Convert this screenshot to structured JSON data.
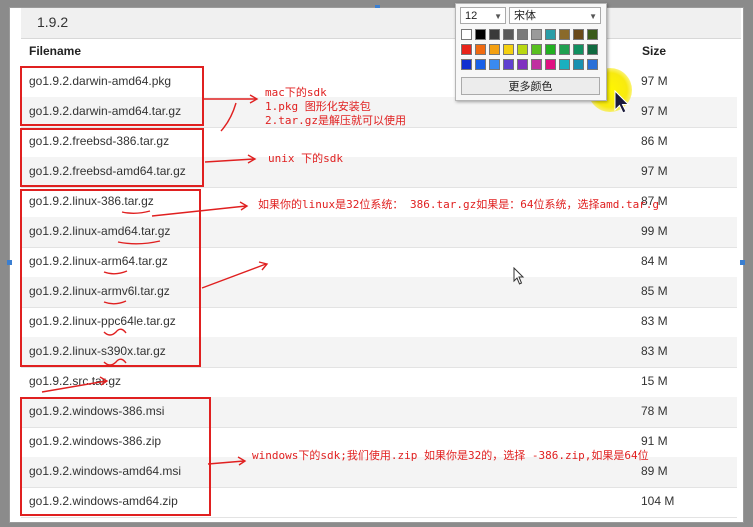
{
  "version": "1.9.2",
  "columns": {
    "filename": "Filename",
    "size": "Size"
  },
  "files": [
    {
      "name": "go1.9.2.darwin-amd64.pkg",
      "size": "97 M"
    },
    {
      "name": "go1.9.2.darwin-amd64.tar.gz",
      "size": "97 M"
    },
    {
      "name": "go1.9.2.freebsd-386.tar.gz",
      "size": "86 M"
    },
    {
      "name": "go1.9.2.freebsd-amd64.tar.gz",
      "size": "97 M"
    },
    {
      "name": "go1.9.2.linux-386.tar.gz",
      "size": "87 M"
    },
    {
      "name": "go1.9.2.linux-amd64.tar.gz",
      "size": "99 M"
    },
    {
      "name": "go1.9.2.linux-arm64.tar.gz",
      "size": "84 M"
    },
    {
      "name": "go1.9.2.linux-armv6l.tar.gz",
      "size": "85 M"
    },
    {
      "name": "go1.9.2.linux-ppc64le.tar.gz",
      "size": "83 M"
    },
    {
      "name": "go1.9.2.linux-s390x.tar.gz",
      "size": "83 M"
    },
    {
      "name": "go1.9.2.src.tar.gz",
      "size": "15 M"
    },
    {
      "name": "go1.9.2.windows-386.msi",
      "size": "78 M"
    },
    {
      "name": "go1.9.2.windows-386.zip",
      "size": "91 M"
    },
    {
      "name": "go1.9.2.windows-amd64.msi",
      "size": "89 M"
    },
    {
      "name": "go1.9.2.windows-amd64.zip",
      "size": "104 M"
    }
  ],
  "annotations": {
    "mac_title": "mac下的sdk",
    "mac_line1": "1.pkg 图形化安装包",
    "mac_line2": "2.tar.gz是解压就可以使用",
    "unix": "unix 下的sdk",
    "linux": "如果你的linux是32位系统： 386.tar.gz如果是：64位系统，选择amd.tar.g",
    "windows": "windows下的sdk;我们使用.zip 如果你是32的，选择 -386.zip,如果是64位"
  },
  "palette": {
    "font_size": "12",
    "font_name": "宋体",
    "more_colors": "更多颜色",
    "colors": [
      "#ffffff",
      "#000000",
      "#3a3a3a",
      "#5a5a5a",
      "#7a7a7a",
      "#9a9a9a",
      "#2a9da8",
      "#8a6a2a",
      "#6a4a1a",
      "#3a5a1a",
      "#e8241a",
      "#f06a10",
      "#f4a010",
      "#f4d010",
      "#b8d810",
      "#58c020",
      "#20b020",
      "#20a050",
      "#109060",
      "#106a40",
      "#1030d0",
      "#1860e8",
      "#3a8af0",
      "#6040d0",
      "#8030c0",
      "#c030a0",
      "#e01080",
      "#1ab0c0",
      "#1890b0",
      "#2a70d8"
    ]
  },
  "accent_color": "#e02020"
}
